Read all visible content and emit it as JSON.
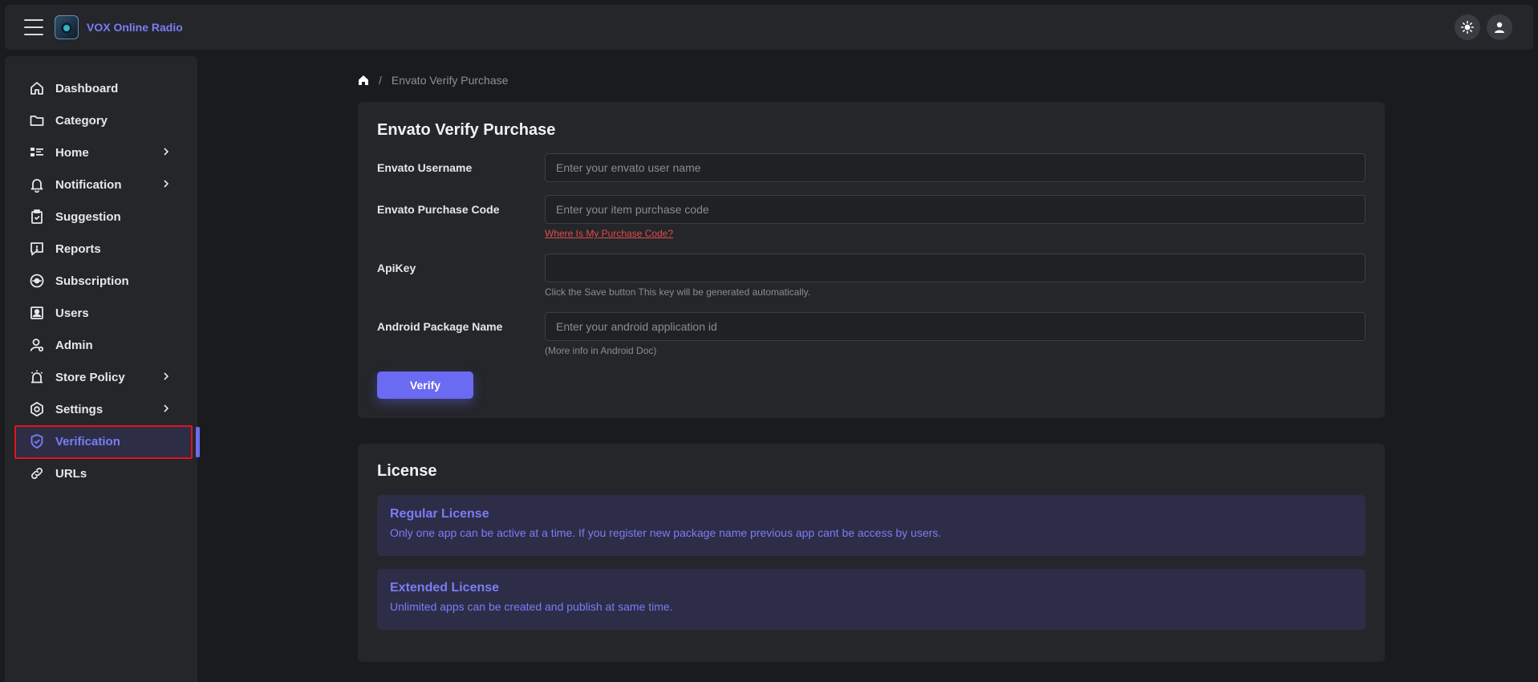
{
  "app": {
    "title": "VOX Online Radio"
  },
  "header": {
    "theme_icon": "sun-icon",
    "profile_icon": "user-icon"
  },
  "sidebar": {
    "items": [
      {
        "label": "Dashboard",
        "icon": "home-icon"
      },
      {
        "label": "Category",
        "icon": "folder-icon"
      },
      {
        "label": "Home",
        "icon": "layout-list-icon",
        "has_submenu": true
      },
      {
        "label": "Notification",
        "icon": "bell-icon",
        "has_submenu": true
      },
      {
        "label": "Suggestion",
        "icon": "clipboard-icon"
      },
      {
        "label": "Reports",
        "icon": "report-icon"
      },
      {
        "label": "Subscription",
        "icon": "subscription-icon"
      },
      {
        "label": "Users",
        "icon": "users-icon"
      },
      {
        "label": "Admin",
        "icon": "admin-icon"
      },
      {
        "label": "Store Policy",
        "icon": "alarm-icon",
        "has_submenu": true
      },
      {
        "label": "Settings",
        "icon": "settings-icon",
        "has_submenu": true
      },
      {
        "label": "Verification",
        "icon": "shield-check-icon",
        "active": true
      },
      {
        "label": "URLs",
        "icon": "link-icon"
      }
    ]
  },
  "breadcrumb": {
    "separator": "/",
    "current": "Envato Verify Purchase"
  },
  "verify_form": {
    "title": "Envato Verify Purchase",
    "username": {
      "label": "Envato Username",
      "placeholder": "Enter your envato user name",
      "value": ""
    },
    "purchase_code": {
      "label": "Envato Purchase Code",
      "placeholder": "Enter your item purchase code",
      "value": "",
      "help_link": "Where Is My Purchase Code?"
    },
    "api_key": {
      "label": "ApiKey",
      "value": "",
      "help": "Click the Save button This key will be generated automatically."
    },
    "package_name": {
      "label": "Android Package Name",
      "placeholder": "Enter your android application id",
      "value": "",
      "help": "(More info in Android Doc)"
    },
    "submit_label": "Verify"
  },
  "license": {
    "title": "License",
    "regular": {
      "title": "Regular License",
      "text": "Only one app can be active at a time. If you register new package name previous app cant be access by users."
    },
    "extended": {
      "title": "Extended License",
      "text": "Unlimited apps can be created and publish at same time."
    }
  },
  "colors": {
    "accent": "#6b6af2",
    "background": "#1a1b1e",
    "panel": "#24262a",
    "highlight": "#e0141c"
  }
}
